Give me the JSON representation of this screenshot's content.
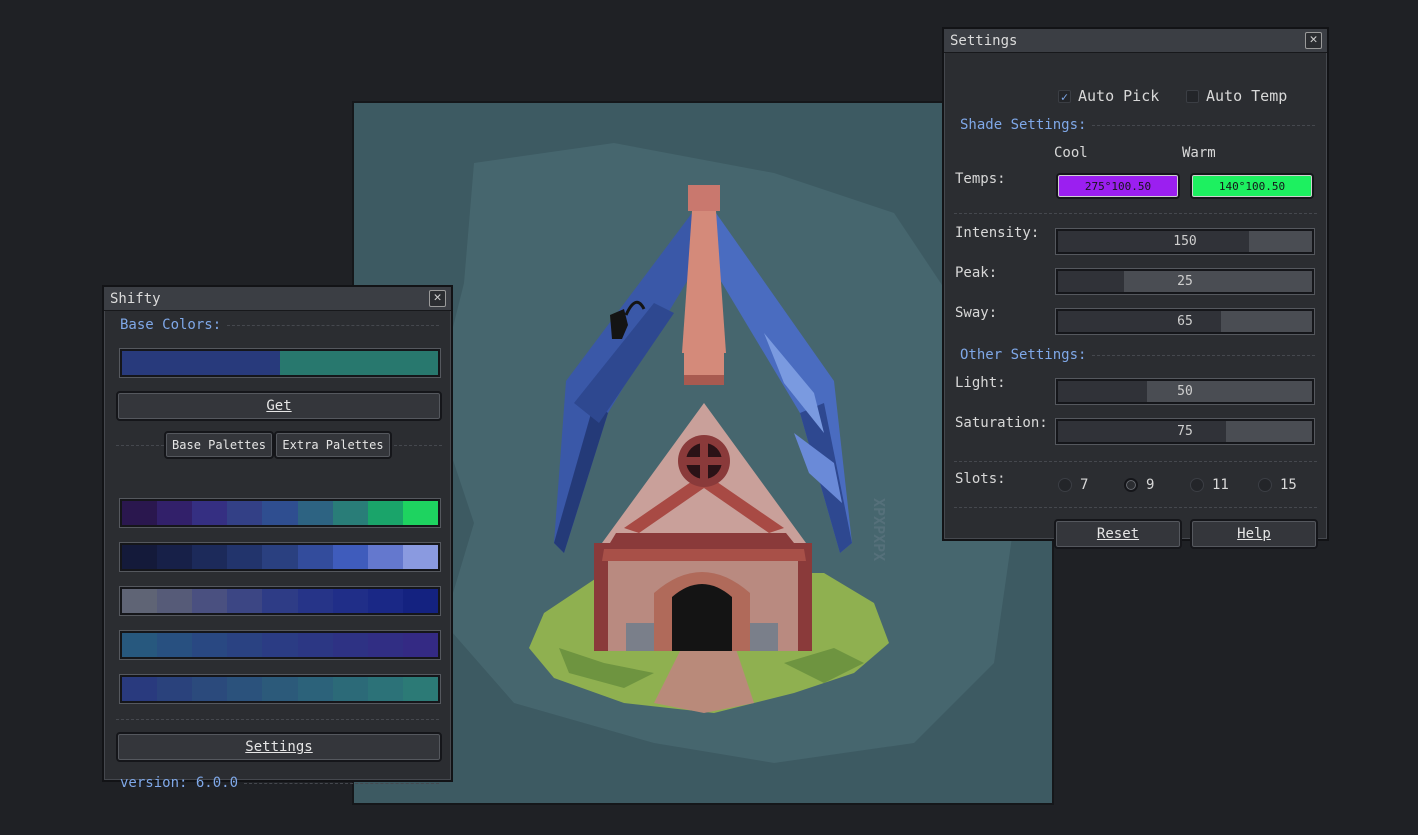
{
  "shifty": {
    "title": "Shifty",
    "base_colors_label": "Base Colors:",
    "base_colors": [
      "#283a7c",
      "#28786e"
    ],
    "get_button": "Get",
    "tabs": [
      "Base Palettes",
      "Extra Palettes"
    ],
    "palettes": [
      [
        "#2a174e",
        "#32206a",
        "#352f82",
        "#334086",
        "#2f4e90",
        "#2d6382",
        "#297d78",
        "#1aa46a",
        "#1ed360"
      ],
      [
        "#141a3a",
        "#172048",
        "#1c2a5a",
        "#22346c",
        "#2a4080",
        "#334c9c",
        "#3f5cbc",
        "#6478ce",
        "#8a9ae0"
      ],
      [
        "#5f6475",
        "#565b78",
        "#4a5080",
        "#3c4684",
        "#2e3c86",
        "#263488",
        "#202e88",
        "#1a2886",
        "#142280"
      ],
      [
        "#27587e",
        "#285080",
        "#294882",
        "#2a4282",
        "#2b3c84",
        "#2c3784",
        "#2e3284",
        "#312e84",
        "#342a84"
      ],
      [
        "#293a7e",
        "#2a427c",
        "#2b4a7c",
        "#2b527c",
        "#2c5a7a",
        "#2c627a",
        "#2c6a78",
        "#2c7278",
        "#2c7a76"
      ]
    ],
    "settings_button": "Settings",
    "version": "version: 6.0.0"
  },
  "settings": {
    "title": "Settings",
    "auto_pick": {
      "label": "Auto Pick",
      "checked": true
    },
    "auto_temp": {
      "label": "Auto Temp",
      "checked": false
    },
    "shade_settings_label": "Shade Settings:",
    "cool_label": "Cool",
    "warm_label": "Warm",
    "temps_label": "Temps:",
    "cool_value": "275°100.50",
    "cool_color": "#9b1ff0",
    "warm_value": "140°100.50",
    "warm_color": "#1df060",
    "intensity": {
      "label": "Intensity:",
      "value": "150",
      "fraction": 0.75
    },
    "peak": {
      "label": "Peak:",
      "value": "25",
      "fraction": 0.26
    },
    "sway": {
      "label": "Sway:",
      "value": "65",
      "fraction": 0.64
    },
    "other_settings_label": "Other Settings:",
    "light": {
      "label": "Light:",
      "value": "50",
      "fraction": 0.35
    },
    "saturation": {
      "label": "Saturation:",
      "value": "75",
      "fraction": 0.66
    },
    "slots_label": "Slots:",
    "slots": [
      "7",
      "9",
      "11",
      "15"
    ],
    "slots_selected": "9",
    "reset_button": "Reset",
    "help_button": "Help"
  },
  "canvas": {
    "watermark": "XPXPXPX",
    "colors": {
      "background": "#3d5a62",
      "roof": "#3a58a8",
      "roof_dark": "#243a78",
      "wall": "#c08a7a",
      "beam": "#8a3a3a",
      "grass": "#8fb050"
    }
  }
}
